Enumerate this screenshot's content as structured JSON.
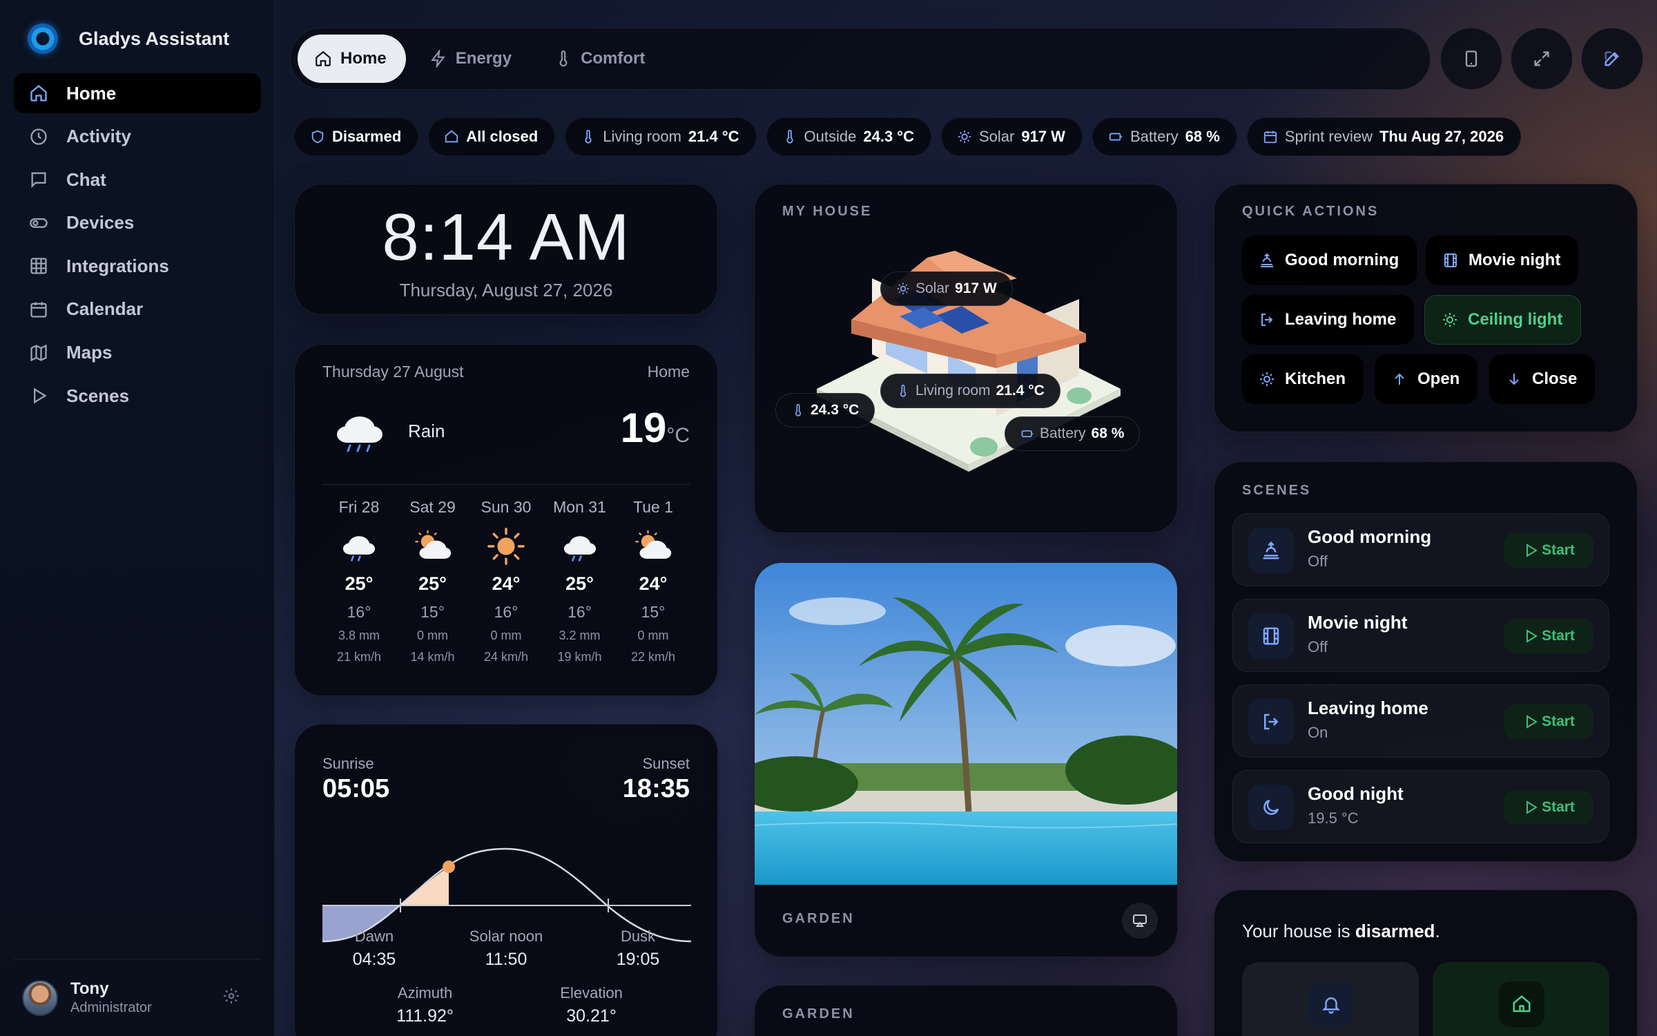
{
  "app": {
    "name": "Gladys Assistant"
  },
  "sidebar": {
    "items": [
      {
        "label": "Home",
        "icon": "home-icon",
        "active": true
      },
      {
        "label": "Activity",
        "icon": "clock-icon"
      },
      {
        "label": "Chat",
        "icon": "chat-icon"
      },
      {
        "label": "Devices",
        "icon": "toggle-icon"
      },
      {
        "label": "Integrations",
        "icon": "grid-icon"
      },
      {
        "label": "Calendar",
        "icon": "calendar-icon"
      },
      {
        "label": "Maps",
        "icon": "map-icon"
      },
      {
        "label": "Scenes",
        "icon": "play-icon"
      }
    ],
    "user": {
      "name": "Tony",
      "role": "Administrator"
    }
  },
  "tabs": [
    {
      "label": "Home",
      "icon": "home-icon",
      "active": true
    },
    {
      "label": "Energy",
      "icon": "bolt-icon"
    },
    {
      "label": "Comfort",
      "icon": "thermometer-icon"
    }
  ],
  "status": {
    "alarm": "Disarmed",
    "doors": "All closed",
    "living_room": {
      "label": "Living room",
      "value": "21.4 °C"
    },
    "outside": {
      "label": "Outside",
      "value": "24.3 °C"
    },
    "solar": {
      "label": "Solar",
      "value": "917 W"
    },
    "battery": {
      "label": "Battery",
      "value": "68 %"
    },
    "event": {
      "label": "Sprint review",
      "value": "Thu Aug 27, 2026"
    }
  },
  "clock": {
    "time": "8:14 AM",
    "date": "Thursday, August 27, 2026"
  },
  "weather": {
    "date": "Thursday 27 August",
    "location": "Home",
    "condition": "Rain",
    "temp": "19",
    "unit": "°C",
    "forecast": [
      {
        "day": "Fri 28",
        "icon": "rain-cloud-icon",
        "hi": "25°",
        "lo": "16°",
        "rain": "3.8 mm",
        "wind": "21 km/h"
      },
      {
        "day": "Sat 29",
        "icon": "partly-sunny-icon",
        "hi": "25°",
        "lo": "15°",
        "rain": "0 mm",
        "wind": "14 km/h"
      },
      {
        "day": "Sun 30",
        "icon": "sun-icon",
        "hi": "24°",
        "lo": "16°",
        "rain": "0 mm",
        "wind": "24 km/h"
      },
      {
        "day": "Mon 31",
        "icon": "rain-cloud-icon",
        "hi": "25°",
        "lo": "16°",
        "rain": "3.2 mm",
        "wind": "19 km/h"
      },
      {
        "day": "Tue 1",
        "icon": "partly-sunny-icon",
        "hi": "24°",
        "lo": "15°",
        "rain": "0 mm",
        "wind": "22 km/h"
      }
    ]
  },
  "sun": {
    "sunrise_label": "Sunrise",
    "sunrise": "05:05",
    "sunset_label": "Sunset",
    "sunset": "18:35",
    "dawn_label": "Dawn",
    "dawn": "04:35",
    "noon_label": "Solar noon",
    "noon": "11:50",
    "dusk_label": "Dusk",
    "dusk": "19:05",
    "azimuth_label": "Azimuth",
    "azimuth": "111.92°",
    "elevation_label": "Elevation",
    "elevation": "30.21°"
  },
  "house": {
    "title": "MY HOUSE",
    "solar": {
      "label": "Solar",
      "value": "917 W"
    },
    "living_room": {
      "label": "Living room",
      "value": "21.4 °C"
    },
    "outside": {
      "value": "24.3 °C"
    },
    "battery": {
      "label": "Battery",
      "value": "68 %"
    }
  },
  "camera": {
    "title": "GARDEN"
  },
  "camera2": {
    "title": "GARDEN"
  },
  "quick_actions": {
    "title": "QUICK ACTIONS",
    "items": [
      {
        "label": "Good morning",
        "icon": "sunrise-icon"
      },
      {
        "label": "Movie night",
        "icon": "film-icon"
      },
      {
        "label": "Leaving home",
        "icon": "logout-icon"
      },
      {
        "label": "Ceiling light",
        "icon": "light-icon",
        "on": true
      },
      {
        "label": "Kitchen",
        "icon": "light-icon"
      },
      {
        "label": "Open",
        "icon": "arrow-up-icon"
      },
      {
        "label": "Close",
        "icon": "arrow-down-icon"
      }
    ]
  },
  "scenes": {
    "title": "SCENES",
    "start_label": "Start",
    "items": [
      {
        "name": "Good morning",
        "state": "Off",
        "icon": "sunrise-icon"
      },
      {
        "name": "Movie night",
        "state": "Off",
        "icon": "film-icon"
      },
      {
        "name": "Leaving home",
        "state": "On",
        "icon": "logout-icon"
      },
      {
        "name": "Good night",
        "state": "19.5 °C",
        "icon": "moon-icon"
      }
    ]
  },
  "alarm": {
    "text_pre": "Your house is ",
    "text_bold": "disarmed",
    "text_post": "."
  },
  "colors": {
    "accent": "#7fa7ff",
    "active_green": "#4fd08b",
    "sun": "#f2a35e"
  }
}
